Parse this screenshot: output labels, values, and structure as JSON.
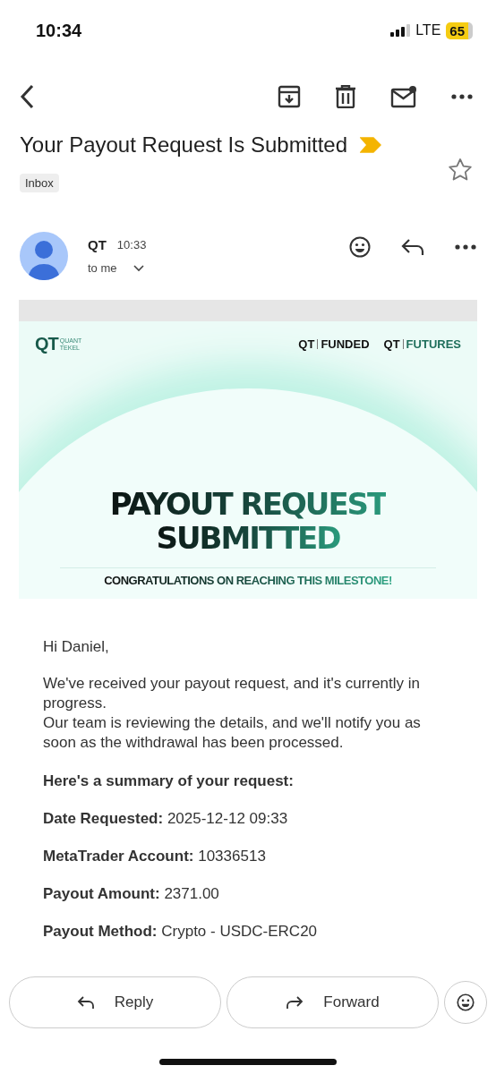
{
  "status_bar": {
    "time": "10:34",
    "network": "LTE",
    "battery": "65"
  },
  "subject": "Your Payout Request Is Submitted",
  "important": true,
  "starred": false,
  "label": "Inbox",
  "sender": {
    "name": "QT",
    "time": "10:33",
    "recipient": "to me"
  },
  "banner": {
    "logo": "QT",
    "logo_caption": "QUANT TEKEL",
    "brands": [
      {
        "mark": "QT",
        "name": "FUNDED"
      },
      {
        "mark": "QT",
        "name": "FUTURES"
      }
    ],
    "headline": [
      "PAYOUT REQUEST",
      "SUBMITTED"
    ],
    "tagline": "CONGRATULATIONS ON REACHING THIS MILESTONE!"
  },
  "body": {
    "greeting": "Hi Daniel,",
    "paragraphs": [
      "We've received your payout request, and it's currently in progress.",
      "Our team is reviewing the details, and we'll notify you as soon as the withdrawal has been processed."
    ],
    "summary_title": "Here's a summary of your request:",
    "details": [
      {
        "label": "Date Requested:",
        "value": "2025-12-12 09:33"
      },
      {
        "label": "MetaTrader Account:",
        "value": "10336513"
      },
      {
        "label": "Payout Amount:",
        "value": "2371.00"
      },
      {
        "label": "Payout Method:",
        "value": "Crypto - USDC-ERC20"
      }
    ]
  },
  "actions": [
    {
      "label": "Reply",
      "kind": "reply"
    },
    {
      "label": "Forward",
      "kind": "forward"
    }
  ]
}
